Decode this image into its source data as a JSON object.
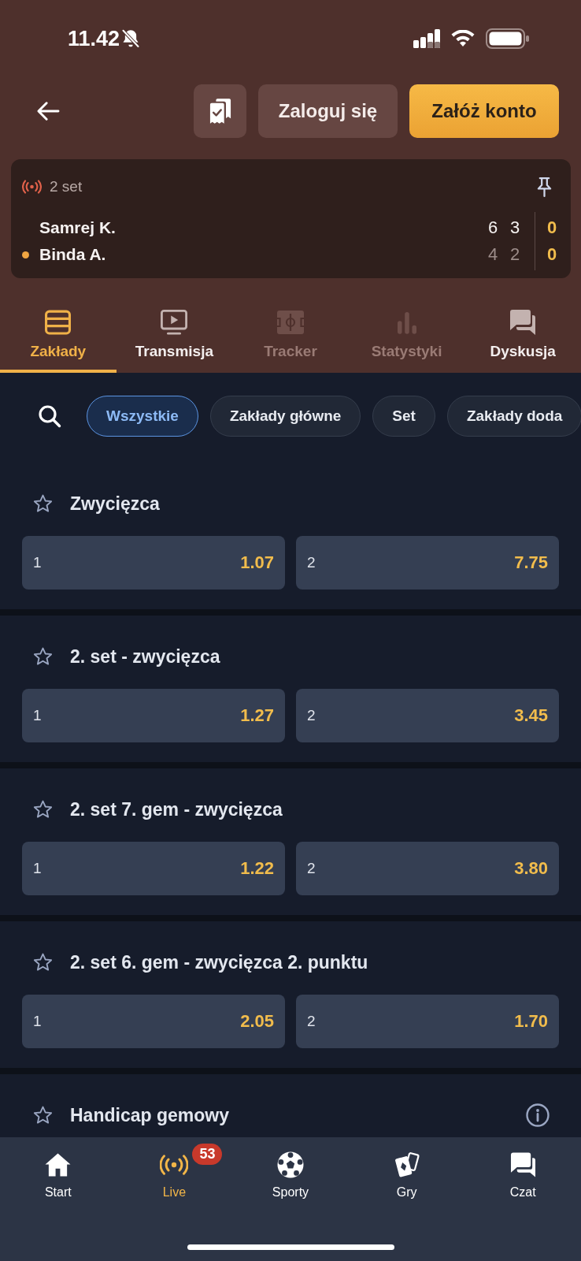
{
  "status_bar": {
    "time": "11.42"
  },
  "header": {
    "login_button": "Zaloguj się",
    "register_button": "Załóż konto"
  },
  "scoreboard": {
    "period": "2 set",
    "players": [
      {
        "name": "Samrej K.",
        "serving": false,
        "sets": [
          {
            "score": "6",
            "leading": true
          },
          {
            "score": "3",
            "leading": true
          }
        ],
        "points": "0"
      },
      {
        "name": "Binda A.",
        "serving": true,
        "sets": [
          {
            "score": "4",
            "leading": false
          },
          {
            "score": "2",
            "leading": false
          }
        ],
        "points": "0"
      }
    ]
  },
  "tabs": [
    {
      "label": "Zakłady",
      "selected": true,
      "disabled": false
    },
    {
      "label": "Transmisja",
      "selected": false,
      "disabled": false
    },
    {
      "label": "Tracker",
      "selected": false,
      "disabled": true
    },
    {
      "label": "Statystyki",
      "selected": false,
      "disabled": true
    },
    {
      "label": "Dyskusja",
      "selected": false,
      "disabled": false
    }
  ],
  "filters": [
    {
      "label": "Wszystkie",
      "selected": true
    },
    {
      "label": "Zakłady główne",
      "selected": false
    },
    {
      "label": "Set",
      "selected": false
    },
    {
      "label": "Zakłady doda",
      "selected": false
    }
  ],
  "markets": [
    {
      "title": "Zwycięzca",
      "favorite": false,
      "info": false,
      "odds": [
        {
          "label": "1",
          "price": "1.07"
        },
        {
          "label": "2",
          "price": "7.75"
        }
      ]
    },
    {
      "title": "2. set - zwycięzca",
      "favorite": false,
      "info": false,
      "odds": [
        {
          "label": "1",
          "price": "1.27"
        },
        {
          "label": "2",
          "price": "3.45"
        }
      ]
    },
    {
      "title": "2. set 7. gem - zwycięzca",
      "favorite": false,
      "info": false,
      "odds": [
        {
          "label": "1",
          "price": "1.22"
        },
        {
          "label": "2",
          "price": "3.80"
        }
      ]
    },
    {
      "title": "2. set 6. gem - zwycięzca 2. punktu",
      "favorite": false,
      "info": false,
      "odds": [
        {
          "label": "1",
          "price": "2.05"
        },
        {
          "label": "2",
          "price": "1.70"
        }
      ]
    },
    {
      "title": "Handicap gemowy",
      "favorite": false,
      "info": true
    }
  ],
  "bottom_nav": [
    {
      "label": "Start",
      "selected": false
    },
    {
      "label": "Live",
      "selected": true,
      "badge": "53"
    },
    {
      "label": "Sporty",
      "selected": false
    },
    {
      "label": "Gry",
      "selected": false
    },
    {
      "label": "Czat",
      "selected": false
    }
  ]
}
